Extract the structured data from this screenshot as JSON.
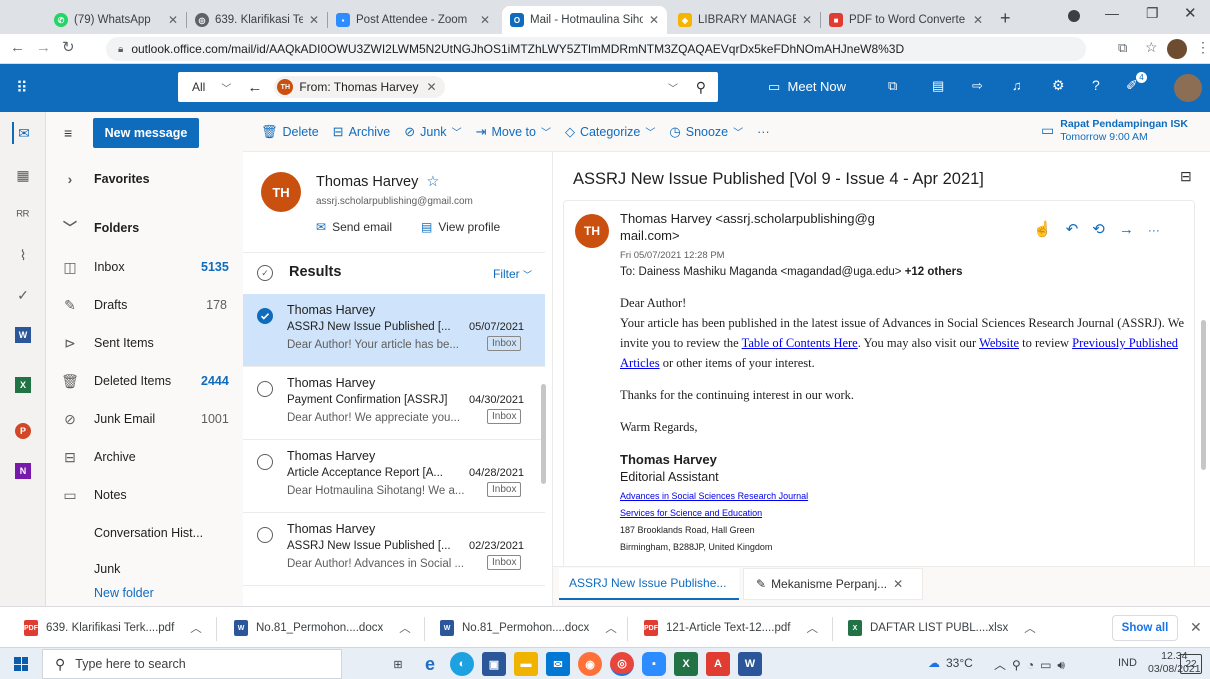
{
  "browser": {
    "tabs": [
      {
        "label": "(79) WhatsApp",
        "color": "#25d366"
      },
      {
        "label": "639. Klarifikasi Terkait",
        "color": "#5f6368"
      },
      {
        "label": "Post Attendee - Zoom",
        "color": "#2d8cff"
      },
      {
        "label": "Mail - Hotmaulina Siho",
        "color": "#0f6cbd"
      },
      {
        "label": "LIBRARY MANAGEMEI",
        "color": "#f4b400"
      },
      {
        "label": "PDF to Word Converte",
        "color": "#e03c31"
      }
    ],
    "url": "outlook.office.com/mail/id/AAQkADI0OWU3ZWI2LWM5N2UtNGJhOS1iMTZhLWY5ZTlmMDRmNTM3ZQAQAEVqrDx5keFDhNOmAHJneW8%3D"
  },
  "header": {
    "search_scope": "All",
    "filter_initials": "TH",
    "filter_label": "From: Thomas Harvey",
    "meet_now": "Meet Now",
    "notif_count": "4"
  },
  "commands": {
    "new_message": "New message",
    "delete": "Delete",
    "archive": "Archive",
    "junk": "Junk",
    "move_to": "Move to",
    "categorize": "Categorize",
    "snooze": "Snooze",
    "more": "···"
  },
  "reminder": {
    "title": "Rapat Pendampingan ISK",
    "time": "Tomorrow 9:00 AM"
  },
  "nav": {
    "favorites": "Favorites",
    "folders": "Folders",
    "items": [
      {
        "label": "Inbox",
        "count": "5135"
      },
      {
        "label": "Drafts",
        "count": "178"
      },
      {
        "label": "Sent Items",
        "count": ""
      },
      {
        "label": "Deleted Items",
        "count": "2444"
      },
      {
        "label": "Junk Email",
        "count": "1001"
      },
      {
        "label": "Archive",
        "count": ""
      },
      {
        "label": "Notes",
        "count": ""
      }
    ],
    "conversation_history": "Conversation Hist...",
    "junk": "Junk",
    "new_folder": "New folder"
  },
  "contact": {
    "initials": "TH",
    "name": "Thomas Harvey",
    "email": "assrj.scholarpublishing@gmail.com",
    "send_email": "Send email",
    "view_profile": "View profile"
  },
  "results": {
    "title": "Results",
    "filter": "Filter"
  },
  "messages": [
    {
      "from": "Thomas Harvey",
      "subject": "ASSRJ New Issue Published [...",
      "date": "05/07/2021",
      "preview": "Dear Author! Your article has be...",
      "folder": "Inbox"
    },
    {
      "from": "Thomas Harvey",
      "subject": "Payment Confirmation [ASSRJ]",
      "date": "04/30/2021",
      "preview": "Dear Author! We appreciate you...",
      "folder": "Inbox"
    },
    {
      "from": "Thomas Harvey",
      "subject": "Article Acceptance Report [A...",
      "date": "04/28/2021",
      "preview": "Dear Hotmaulina Sihotang! We a...",
      "folder": "Inbox"
    },
    {
      "from": "Thomas Harvey",
      "subject": "ASSRJ New Issue Published [...",
      "date": "02/23/2021",
      "preview": "Dear Author! Advances in Social ...",
      "folder": "Inbox"
    }
  ],
  "email": {
    "subject": "ASSRJ New Issue Published [Vol 9 - Issue 4 - Apr 2021]",
    "sender_initials": "TH",
    "sender_line1": "Thomas Harvey <assrj.scholarpublishing@g",
    "sender_line2": "mail.com>",
    "sent": "Fri 05/07/2021 12:28 PM",
    "to_prefix": "To: ",
    "to": "Dainess Mashiku Maganda <magandad@uga.edu>",
    "others": "+12 others",
    "greeting": "Dear Author!",
    "p1_a": "Your article has been published in the latest issue of Advances in Social Sciences Research Journal (ASSRJ). We invite you to review the ",
    "link_toc": "Table of Contents Here",
    "p1_b": ". You may also visit our ",
    "link_website": "Website",
    "p1_c": " to review ",
    "link_prev": "Previously Published Articles",
    "p1_d": " or other items of your interest.",
    "p2": "Thanks for the continuing interest in our work.",
    "p3": "Warm Regards,",
    "sig_name": "Thomas Harvey",
    "sig_title": "Editorial Assistant",
    "sig_link1": "Advances in Social Sciences Research Journal",
    "sig_link2": "Services for Science and Education",
    "sig_addr1": "187 Brooklands Road, Hall Green",
    "sig_addr2": "Birmingham, B288JP, United Kingdom"
  },
  "bottom_tabs": [
    {
      "label": "ASSRJ New Issue Publishe..."
    },
    {
      "label": "Mekanisme Perpanj..."
    }
  ],
  "downloads": {
    "items": [
      {
        "label": "639. Klarifikasi Terk....pdf",
        "type": "pdf"
      },
      {
        "label": "No.81_Permohon....docx",
        "type": "docx"
      },
      {
        "label": "No.81_Permohon....docx",
        "type": "docx"
      },
      {
        "label": "121-Article Text-12....pdf",
        "type": "pdf"
      },
      {
        "label": "DAFTAR LIST PUBL....xlsx",
        "type": "xlsx"
      }
    ],
    "show_all": "Show all"
  },
  "taskbar": {
    "search_placeholder": "Type here to search",
    "weather": "33°C",
    "lang": "IND",
    "time": "12.34",
    "date": "03/08/2021",
    "notif": "22"
  }
}
